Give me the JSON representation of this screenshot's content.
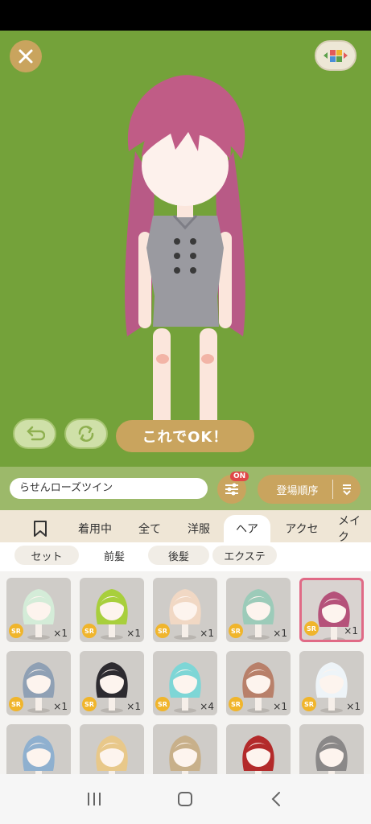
{
  "controls": {
    "ok_label": "これでOK！"
  },
  "item": {
    "name": "らせんローズツイン"
  },
  "filter": {
    "badge": "ON"
  },
  "sort": {
    "label": "登場順序"
  },
  "tabs": [
    {
      "label": "着用中"
    },
    {
      "label": "全て"
    },
    {
      "label": "洋服"
    },
    {
      "label": "ヘア"
    },
    {
      "label": "アクセ"
    },
    {
      "label": "メイク"
    }
  ],
  "subtabs": [
    {
      "label": "セット"
    },
    {
      "label": "前髪"
    },
    {
      "label": "後髪"
    },
    {
      "label": "エクステ"
    }
  ],
  "items": [
    {
      "rarity": "SR",
      "qty": "×1",
      "hair": "#d4ecd8"
    },
    {
      "rarity": "SR",
      "qty": "×1",
      "hair": "#a8cf3c"
    },
    {
      "rarity": "SR",
      "qty": "×1",
      "hair": "#f1d8c4"
    },
    {
      "rarity": "SR",
      "qty": "×1",
      "hair": "#9ccbb9"
    },
    {
      "rarity": "SR",
      "qty": "×1",
      "hair": "#b5527a"
    },
    {
      "rarity": "SR",
      "qty": "×1",
      "hair": "#8fa0b4"
    },
    {
      "rarity": "SR",
      "qty": "×1",
      "hair": "#2d2b30"
    },
    {
      "rarity": "SR",
      "qty": "×4",
      "hair": "#7ed6d6"
    },
    {
      "rarity": "SR",
      "qty": "×1",
      "hair": "#b8806a"
    },
    {
      "rarity": "SR",
      "qty": "×1",
      "hair": "#eef4f8"
    },
    {
      "rarity": "",
      "qty": "",
      "hair": "#8fb0cf"
    },
    {
      "rarity": "",
      "qty": "",
      "hair": "#e8c88a"
    },
    {
      "rarity": "",
      "qty": "",
      "hair": "#c8b08a"
    },
    {
      "rarity": "",
      "qty": "",
      "hair": "#b32a2a"
    },
    {
      "rarity": "",
      "qty": "",
      "hair": "#8a8888"
    }
  ],
  "colors": {
    "stage": "#74a23a",
    "accent": "#c9a45e",
    "hair": "#c05c86",
    "selected": "#e06a86"
  }
}
